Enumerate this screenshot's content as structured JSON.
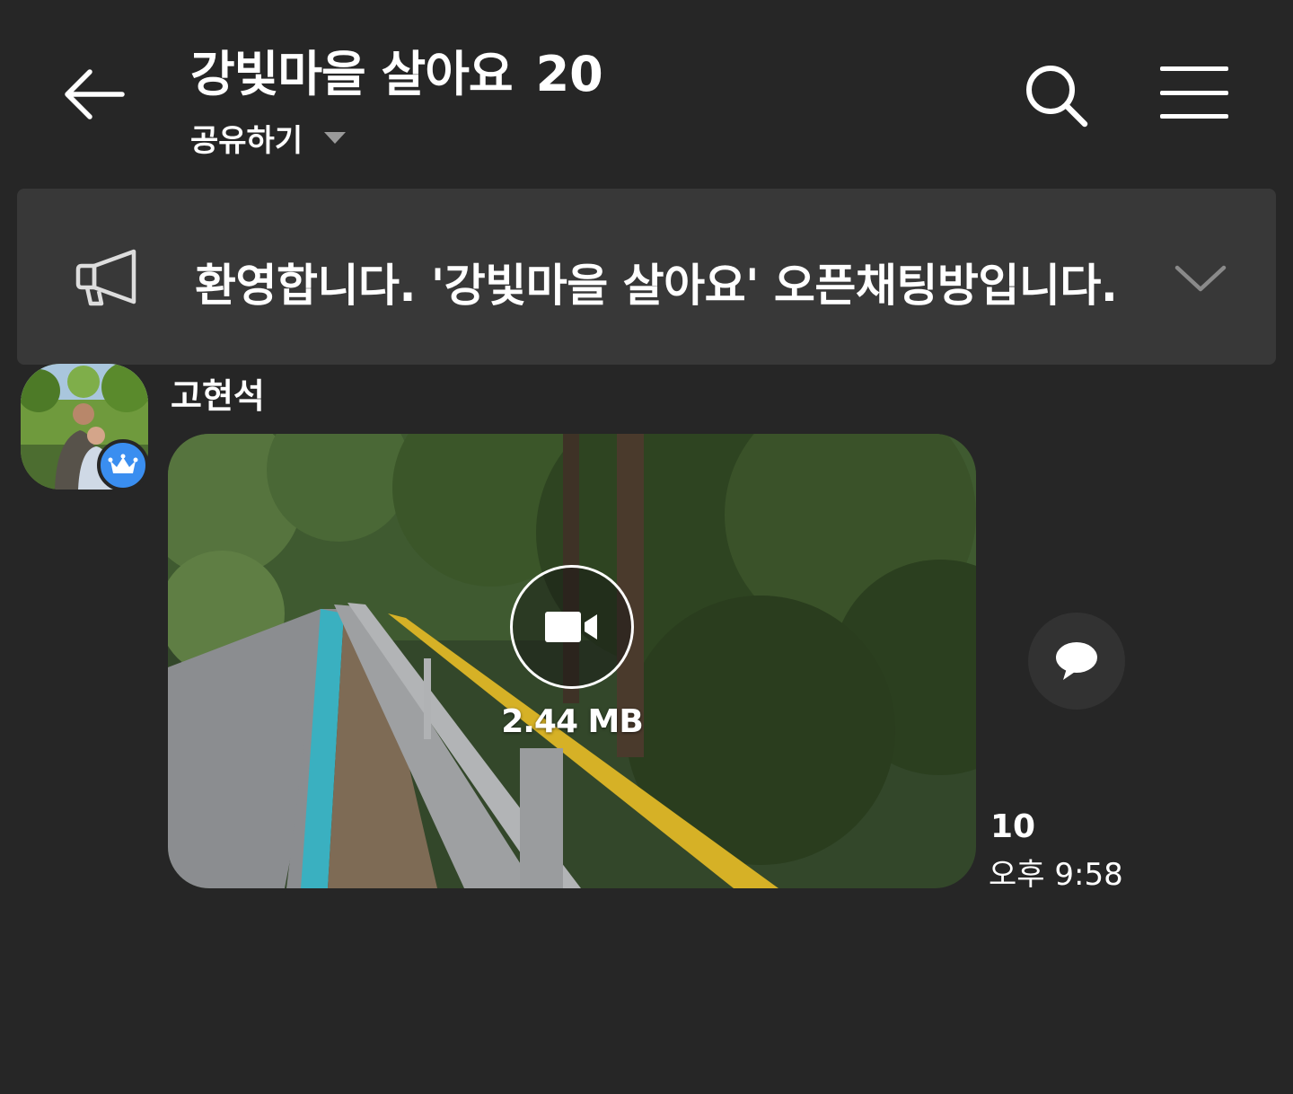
{
  "header": {
    "title": "강빛마을 살아요",
    "member_count": "20",
    "share_label": "공유하기",
    "icons": {
      "back": "back-arrow-icon",
      "search": "search-icon",
      "menu": "hamburger-menu-icon",
      "share_caret": "caret-down-icon"
    }
  },
  "notice": {
    "text": "환영합니다. '강빛마을 살아요' 오픈채팅방입니다.",
    "icons": {
      "announcement": "megaphone-icon",
      "expand": "chevron-down-icon"
    }
  },
  "messages": [
    {
      "sender": "고현석",
      "badge": "crown-icon",
      "type": "video",
      "file_size": "2.44 MB",
      "unread_count": "10",
      "time": "오후 9:58",
      "icons": {
        "video": "video-camera-icon",
        "reply": "speech-bubble-icon"
      }
    }
  ],
  "colors": {
    "background": "#262626",
    "notice_background": "#383838",
    "badge_blue": "#3a8ef0",
    "text": "#ffffff"
  }
}
